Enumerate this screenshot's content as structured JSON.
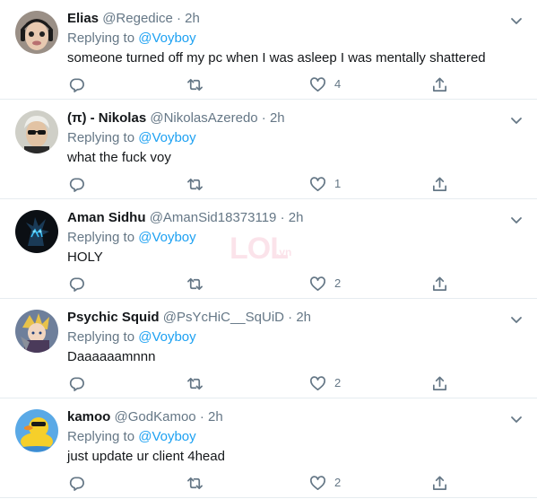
{
  "replying_label": "Replying to",
  "watermark": {
    "main": "LOL",
    "sub": ".vn"
  },
  "tweets": [
    {
      "name": "Elias",
      "handle": "@Regedice",
      "separator": "·",
      "time": "2h",
      "replying_to": "@Voyboy",
      "text": "someone turned off my pc when I was asleep I was mentally shattered",
      "likes": "4",
      "avatar": "avatar-elias"
    },
    {
      "name": "(π) - Nikolas",
      "handle": "@NikolasAzeredo",
      "separator": "·",
      "time": "2h",
      "replying_to": "@Voyboy",
      "text": "what the fuck voy",
      "likes": "1",
      "avatar": "avatar-nikolas"
    },
    {
      "name": "Aman Sidhu",
      "handle": "@AmanSid18373119",
      "separator": "·",
      "time": "2h",
      "replying_to": "@Voyboy",
      "text": "HOLY",
      "likes": "2",
      "avatar": "avatar-aman"
    },
    {
      "name": "Psychic Squid",
      "handle": "@PsYcHiC__SqUiD",
      "separator": "·",
      "time": "2h",
      "replying_to": "@Voyboy",
      "text": "Daaaaaamnnn",
      "likes": "2",
      "avatar": "avatar-psychic-squid"
    },
    {
      "name": "kamoo",
      "handle": "@GodKamoo",
      "separator": "·",
      "time": "2h",
      "replying_to": "@Voyboy",
      "text": "just update ur client 4head",
      "likes": "2",
      "avatar": "avatar-kamoo"
    }
  ],
  "icons": {
    "reply": "reply-icon",
    "retweet": "retweet-icon",
    "like": "heart-icon",
    "share": "share-icon",
    "more": "chevron-down-icon"
  },
  "colors": {
    "text": "#14171a",
    "secondary": "#657786",
    "link": "#1da1f2",
    "divider": "#e6ecf0"
  }
}
